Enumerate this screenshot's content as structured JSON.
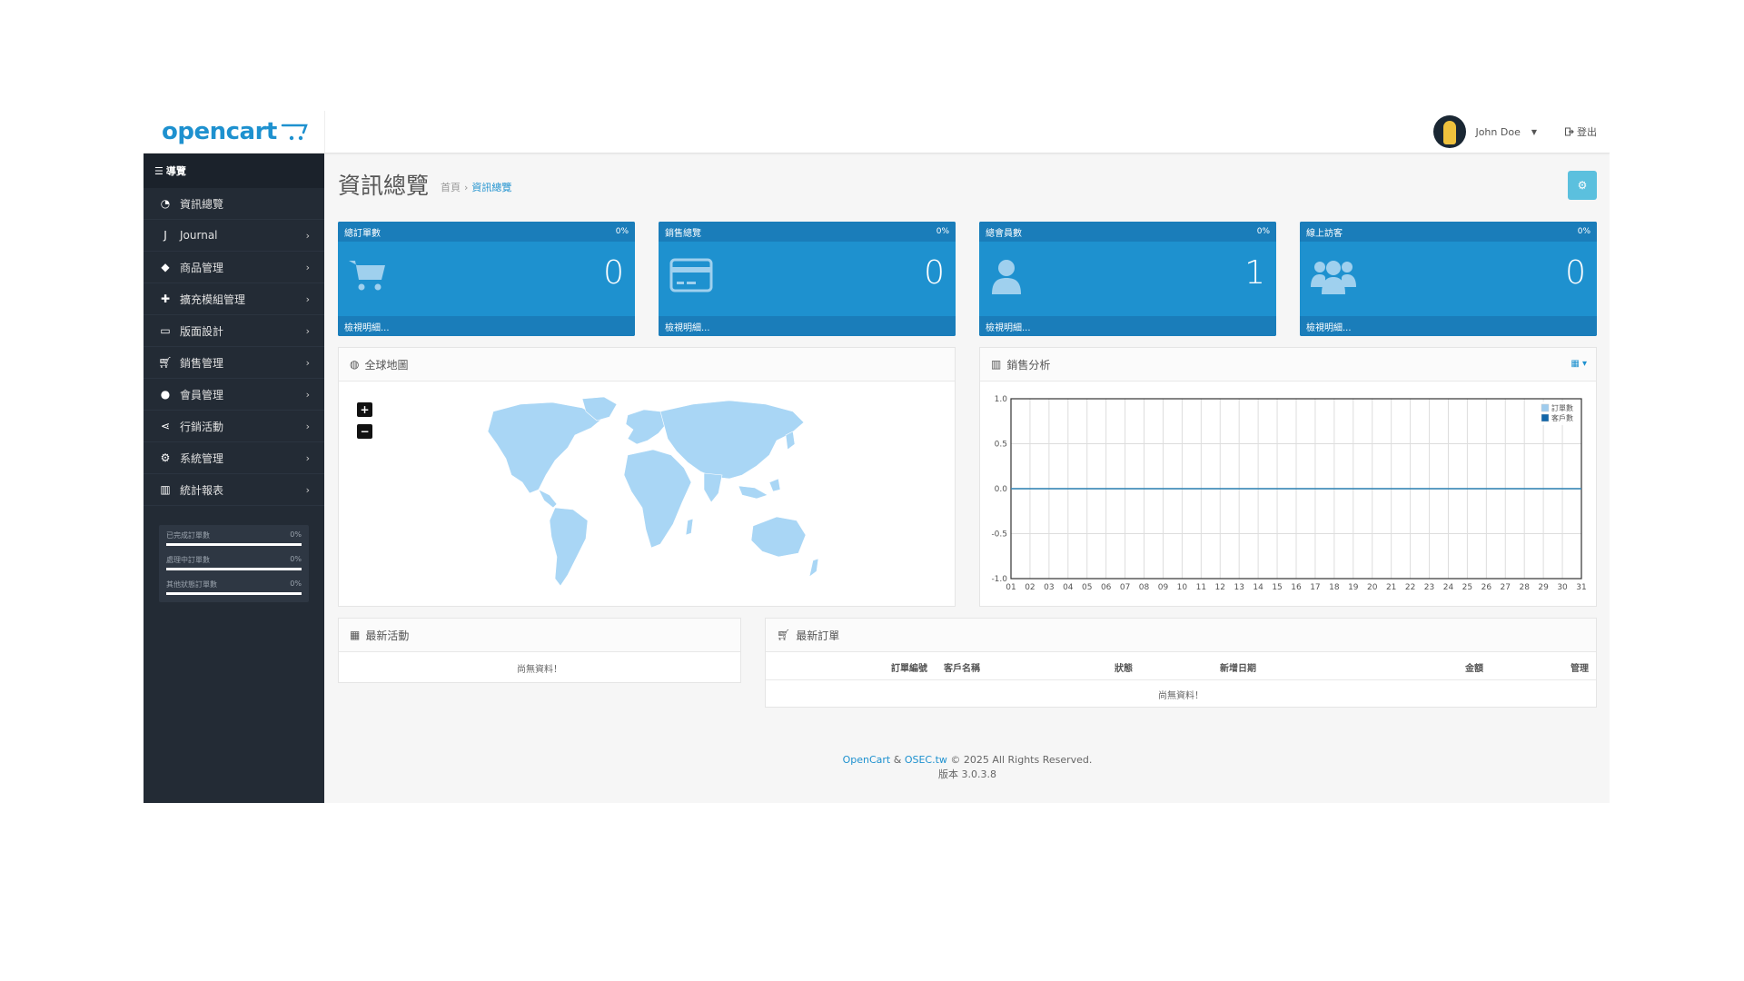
{
  "header": {
    "logo_text": "opencart",
    "user_name": "John Doe",
    "logout_label": "登出"
  },
  "sidebar": {
    "nav_title": "導覽",
    "items": [
      {
        "label": "資訊總覽",
        "icon": "dashboard-icon",
        "arrow": false
      },
      {
        "label": "Journal",
        "icon": "journal-icon",
        "arrow": true
      },
      {
        "label": "商品管理",
        "icon": "tags-icon",
        "arrow": true
      },
      {
        "label": "擴充模組管理",
        "icon": "puzzle-icon",
        "arrow": true
      },
      {
        "label": "版面設計",
        "icon": "desktop-icon",
        "arrow": true
      },
      {
        "label": "銷售管理",
        "icon": "cart-icon",
        "arrow": true
      },
      {
        "label": "會員管理",
        "icon": "user-icon",
        "arrow": true
      },
      {
        "label": "行銷活動",
        "icon": "share-icon",
        "arrow": true
      },
      {
        "label": "系統管理",
        "icon": "gear-icon",
        "arrow": true
      },
      {
        "label": "統計報表",
        "icon": "bar-chart-icon",
        "arrow": true
      }
    ],
    "progress": [
      {
        "label": "已完成訂單數",
        "value": "0%",
        "fraction": 0
      },
      {
        "label": "處理中訂單數",
        "value": "0%",
        "fraction": 0
      },
      {
        "label": "其他狀態訂單數",
        "value": "0%",
        "fraction": 0
      }
    ]
  },
  "page": {
    "title": "資訊總覽",
    "breadcrumb": [
      "首頁",
      "資訊總覽"
    ],
    "breadcrumb_sep": "›"
  },
  "tiles": [
    {
      "title": "總訂單數",
      "percent": "0%",
      "value": "0",
      "footer": "檢視明細...",
      "icon": "cart-icon"
    },
    {
      "title": "銷售總覽",
      "percent": "0%",
      "value": "0",
      "footer": "檢視明細...",
      "icon": "credit-card-icon"
    },
    {
      "title": "總會員數",
      "percent": "0%",
      "value": "1",
      "footer": "檢視明細...",
      "icon": "user-icon"
    },
    {
      "title": "線上訪客",
      "percent": "0%",
      "value": "0",
      "footer": "檢視明細...",
      "icon": "users-icon"
    }
  ],
  "map_panel": {
    "title": "全球地圖",
    "zoom_in": "+",
    "zoom_out": "−"
  },
  "chart_panel": {
    "title": "銷售分析"
  },
  "chart_data": {
    "type": "line",
    "x": [
      "01",
      "02",
      "03",
      "04",
      "05",
      "06",
      "07",
      "08",
      "09",
      "10",
      "11",
      "12",
      "13",
      "14",
      "15",
      "16",
      "17",
      "18",
      "19",
      "20",
      "21",
      "22",
      "23",
      "24",
      "25",
      "26",
      "27",
      "28",
      "29",
      "30",
      "31"
    ],
    "y_ticks": [
      "1.0",
      "0.5",
      "0.0",
      "-0.5",
      "-1.0"
    ],
    "ylim": [
      -1,
      1
    ],
    "grid": true,
    "legend_position": "top-right",
    "series": [
      {
        "name": "訂單數",
        "color": "#9ecbed",
        "values": [
          0,
          0,
          0,
          0,
          0,
          0,
          0,
          0,
          0,
          0,
          0,
          0,
          0,
          0,
          0,
          0,
          0,
          0,
          0,
          0,
          0,
          0,
          0,
          0,
          0,
          0,
          0,
          0,
          0,
          0,
          0
        ]
      },
      {
        "name": "客戶數",
        "color": "#1065a8",
        "values": [
          0,
          0,
          0,
          0,
          0,
          0,
          0,
          0,
          0,
          0,
          0,
          0,
          0,
          0,
          0,
          0,
          0,
          0,
          0,
          0,
          0,
          0,
          0,
          0,
          0,
          0,
          0,
          0,
          0,
          0,
          0
        ]
      }
    ]
  },
  "activity_panel": {
    "title": "最新活動",
    "empty": "尚無資料！"
  },
  "orders_panel": {
    "title": "最新訂單",
    "columns": [
      "訂單編號",
      "客戶名稱",
      "狀態",
      "新增日期",
      "金額",
      "管理"
    ],
    "empty": "尚無資料！"
  },
  "footer": {
    "opencart": "OpenCart",
    "amp": "&",
    "osec": "OSEC.tw",
    "rights": "© 2025 All Rights Reserved.",
    "version": "版本 3.0.3.8"
  },
  "colors": {
    "brand": "#1e91cf",
    "sidebar": "#232b35",
    "tile": "#1e91cf",
    "settings_button": "#5bc0de"
  }
}
